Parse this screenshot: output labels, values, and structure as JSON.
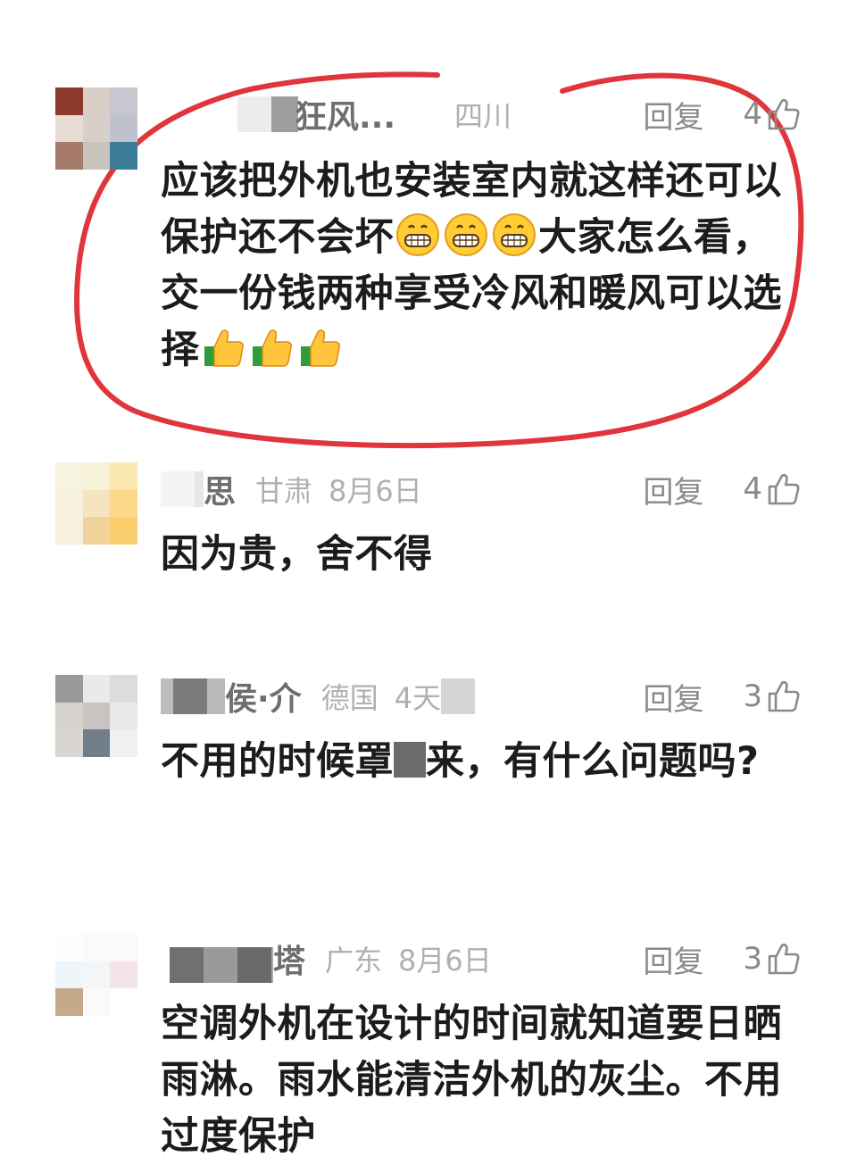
{
  "comments": [
    {
      "username": "狂风...",
      "region": "四川",
      "date": "",
      "reply_label": "回复",
      "likes": "4",
      "text_segments": [
        "应该把外机也安装室内就这样还可以保护还不会坏",
        "大家怎么看，交一份钱两种享受冷风和暖风可以选择"
      ]
    },
    {
      "username": "思",
      "region": "甘肃",
      "date": "8月6日",
      "reply_label": "回复",
      "likes": "4",
      "text": "因为贵，舍不得"
    },
    {
      "username": "侯·介",
      "region": "德国",
      "date": "4天",
      "reply_label": "回复",
      "likes": "3",
      "text_before": "不用的时候罩",
      "text_after": "来，有什么问题吗?"
    },
    {
      "username": "塔",
      "region": "广东",
      "date": "8月6日",
      "reply_label": "回复",
      "likes": "3",
      "text": "空调外机在设计的时间就知道要日晒雨淋。雨水能清洁外机的灰尘。不用过度保护"
    }
  ],
  "icons": {
    "like": "thumbs-up-outline-icon",
    "grin_emoji": "grinning-face-emoji",
    "thumb_emoji": "thumbs-up-emoji"
  },
  "colors": {
    "annotation_circle": "#e0353b",
    "meta_gray": "#8a8a8a",
    "body_text": "#1c1c1c"
  }
}
